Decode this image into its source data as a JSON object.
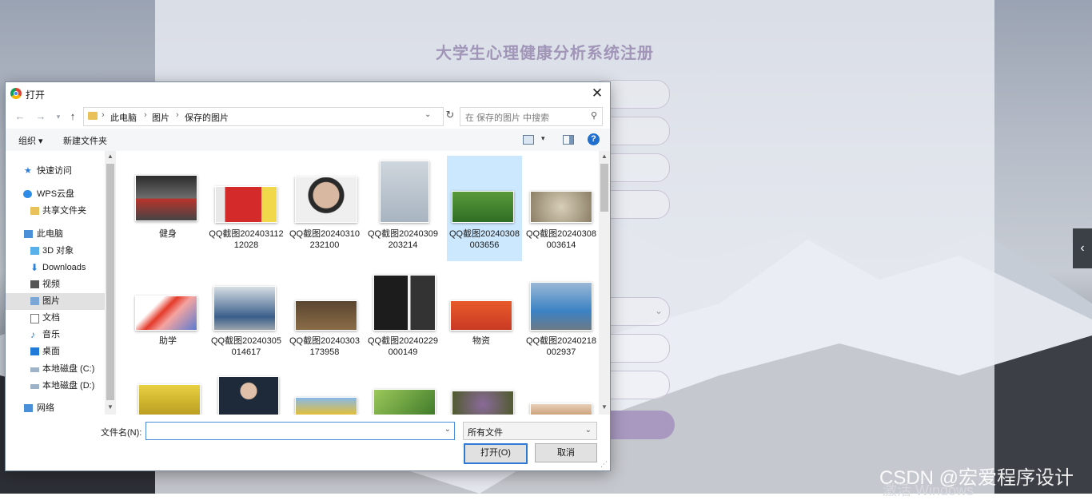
{
  "background": {
    "title": "大学生心理健康分析系统注册",
    "watermark": "CSDN @宏爱程序设计",
    "activate_text": "激活 Windows",
    "side_tab_icon": "chevron-left-icon"
  },
  "dialog": {
    "title": "打开",
    "close_label": "✕",
    "path": [
      "此电脑",
      "图片",
      "保存的图片"
    ],
    "search_placeholder": "在 保存的图片 中搜索",
    "toolbar": {
      "organize": "组织 ▾",
      "new_folder": "新建文件夹",
      "help": "?"
    },
    "nav_items": [
      {
        "label": "快速访问",
        "icon": "star-icon"
      },
      {
        "label": "WPS云盘",
        "icon": "cloud-icon"
      },
      {
        "label": "共享文件夹",
        "icon": "folder-icon"
      },
      {
        "label": "此电脑",
        "icon": "computer-icon"
      },
      {
        "label": "3D 对象",
        "icon": "cube-icon"
      },
      {
        "label": "Downloads",
        "icon": "download-icon"
      },
      {
        "label": "视频",
        "icon": "video-icon"
      },
      {
        "label": "图片",
        "icon": "picture-icon"
      },
      {
        "label": "文档",
        "icon": "document-icon"
      },
      {
        "label": "音乐",
        "icon": "music-icon"
      },
      {
        "label": "桌面",
        "icon": "desktop-icon"
      },
      {
        "label": "本地磁盘 (C:)",
        "icon": "drive-icon"
      },
      {
        "label": "本地磁盘 (D:)",
        "icon": "drive-icon"
      },
      {
        "label": "网络",
        "icon": "network-icon"
      }
    ],
    "selected_nav": "图片",
    "files": [
      {
        "name": "健身"
      },
      {
        "name": "QQ截图20240311212028"
      },
      {
        "name": "QQ截图20240310232100"
      },
      {
        "name": "QQ截图20240309203214"
      },
      {
        "name": "QQ截图20240308003656",
        "selected": true
      },
      {
        "name": "QQ截图20240308003614"
      },
      {
        "name": "助学"
      },
      {
        "name": "QQ截图20240305014617"
      },
      {
        "name": "QQ截图20240303173958"
      },
      {
        "name": "QQ截图20240229000149"
      },
      {
        "name": "物资"
      },
      {
        "name": "QQ截图20240218002937"
      }
    ],
    "filename_label": "文件名(N):",
    "filename_value": "",
    "filetype_value": "所有文件",
    "open_button": "打开(O)",
    "cancel_button": "取消"
  }
}
